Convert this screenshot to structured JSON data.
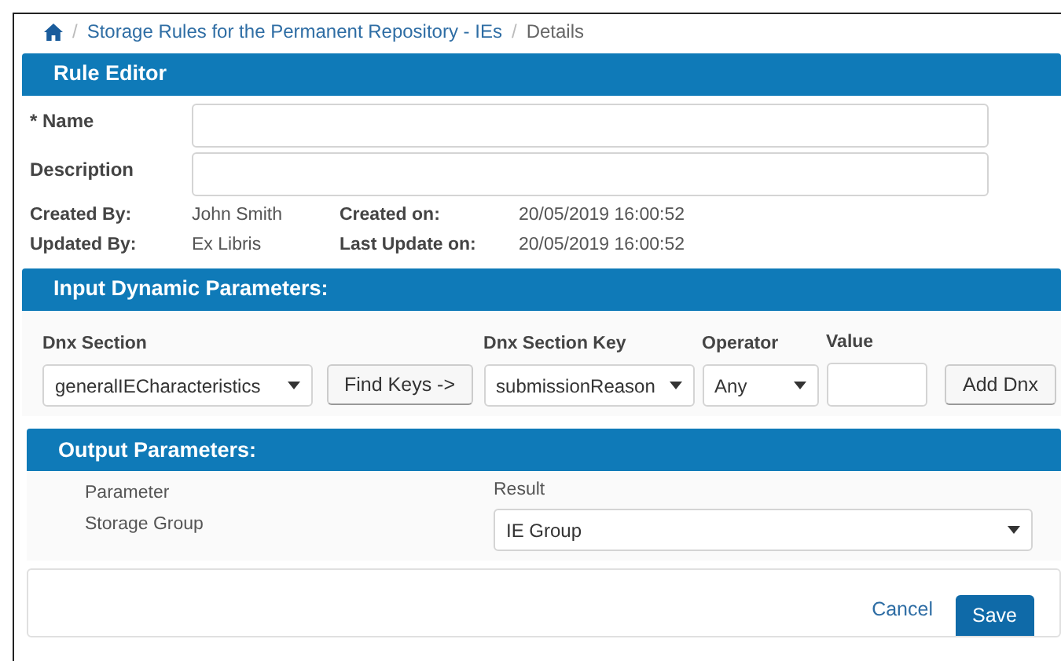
{
  "breadcrumb": {
    "separator": "/",
    "items": [
      {
        "label": "Storage Rules for the Permanent Repository - IEs",
        "kind": "link"
      },
      {
        "label": "Details",
        "kind": "current"
      }
    ]
  },
  "rule_editor": {
    "title": "Rule Editor",
    "fields": [
      {
        "label": "* Name"
      },
      {
        "label": "Description"
      }
    ],
    "info": [
      {
        "label": "Created By:",
        "value": "John Smith",
        "label2": "Created on:",
        "value2": "20/05/2019 16:00:52"
      },
      {
        "label": "Updated By:",
        "value": "Ex Libris",
        "label2": "Last Update on:",
        "value2": "20/05/2019 16:00:52"
      }
    ]
  },
  "input_parameters": {
    "title": "Input Dynamic Parameters:",
    "dnx_section": {
      "label": "Dnx Section",
      "value": "generalIECharacteristics"
    },
    "find_keys": "Find Keys ->",
    "dnx_section_key": {
      "label": "Dnx Section Key",
      "value": "submissionReason"
    },
    "operator": {
      "label": "Operator",
      "value": "Any"
    },
    "value": {
      "label": "Value"
    },
    "add_dnx": "Add Dnx"
  },
  "output_parameters": {
    "title": "Output Parameters:",
    "column_1": "Parameter",
    "column_2": "Result",
    "rows": [
      {
        "parameter": "Storage Group",
        "result": "IE Group"
      }
    ]
  },
  "footer": {
    "cancel": "Cancel",
    "save": "Save"
  }
}
